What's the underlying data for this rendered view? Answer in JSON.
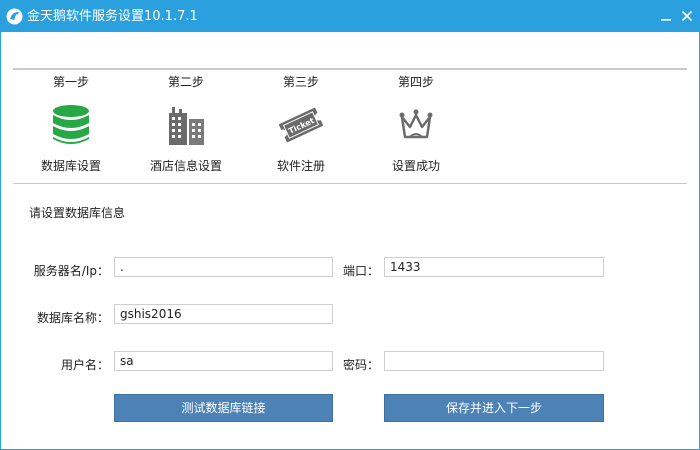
{
  "window": {
    "title": "金天鹅软件服务设置10.1.7.1",
    "colors": {
      "titlebar": "#2aa0de",
      "accent_green": "#28a745",
      "button": "#4c82b6"
    }
  },
  "steps": [
    {
      "label": "第一步",
      "name": "数据库设置",
      "icon": "database-icon",
      "active": true
    },
    {
      "label": "第二步",
      "name": "酒店信息设置",
      "icon": "hotel-building-icon",
      "active": false
    },
    {
      "label": "第三步",
      "name": "软件注册",
      "icon": "ticket-icon",
      "active": false
    },
    {
      "label": "第四步",
      "name": "设置成功",
      "icon": "crown-icon",
      "active": false
    }
  ],
  "ticket_text": "Ticket",
  "form": {
    "section_title": "请设置数据库信息",
    "server": {
      "label": "服务器名/Ip：",
      "value": "."
    },
    "port": {
      "label": "端口：",
      "value": "1433"
    },
    "database": {
      "label": "数据库名称：",
      "value": "gshis2016"
    },
    "username": {
      "label": "用户名：",
      "value": "sa"
    },
    "password": {
      "label": "密码：",
      "value": ""
    }
  },
  "buttons": {
    "test_connection": "测试数据库链接",
    "save_next": "保存并进入下一步"
  }
}
